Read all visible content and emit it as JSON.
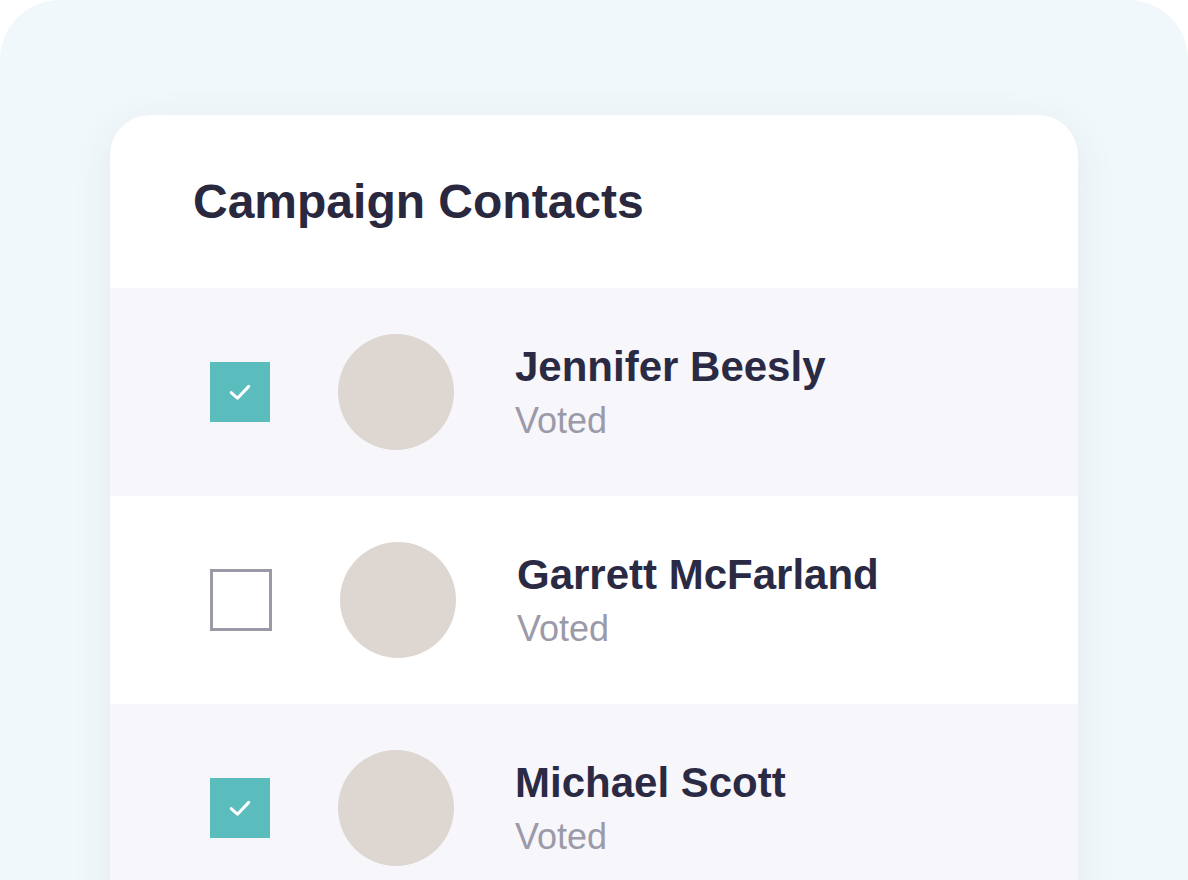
{
  "title": "Campaign Contacts",
  "contacts": [
    {
      "name": "Jennifer Beesly",
      "status": "Voted",
      "checked": true
    },
    {
      "name": "Garrett McFarland",
      "status": "Voted",
      "checked": false
    },
    {
      "name": "Michael Scott",
      "status": "Voted",
      "checked": true
    }
  ]
}
